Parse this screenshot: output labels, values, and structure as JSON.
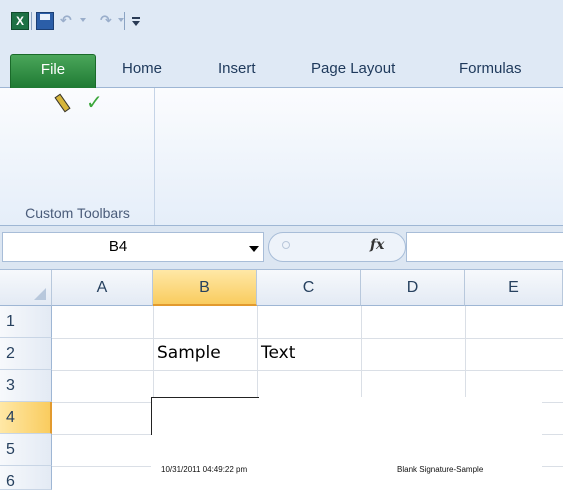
{
  "quick_access": {
    "app_icon_letter": "X",
    "save_icon": "save-icon",
    "undo_icon": "undo-icon",
    "redo_icon": "redo-icon",
    "customize_icon": "customize-toolbar-icon"
  },
  "tabs": [
    {
      "label": "File"
    },
    {
      "label": "Home"
    },
    {
      "label": "Insert"
    },
    {
      "label": "Page Layout"
    },
    {
      "label": "Formulas"
    }
  ],
  "ribbon": {
    "group_label": "Custom Toolbars",
    "buttons": [
      {
        "icon": "pencil-icon"
      },
      {
        "icon": "checkmark-icon"
      }
    ]
  },
  "formula_bar": {
    "name_box_value": "B4",
    "fx_label": "fx",
    "formula_value": ""
  },
  "grid": {
    "columns": [
      "A",
      "B",
      "C",
      "D",
      "E"
    ],
    "active_column": "B",
    "rows": [
      "1",
      "2",
      "3",
      "4",
      "5",
      "6"
    ],
    "active_row": "4",
    "cells": {
      "B2": "Sample",
      "C2": "Text"
    }
  },
  "signature": {
    "timestamp": "10/31/2011 04:49:22 pm",
    "label": "Blank Signature-Sample"
  },
  "colors": {
    "file_tab": "#2a8a3e",
    "active_header": "#f9cc5f",
    "ribbon_bg": "#dfe9f5"
  }
}
